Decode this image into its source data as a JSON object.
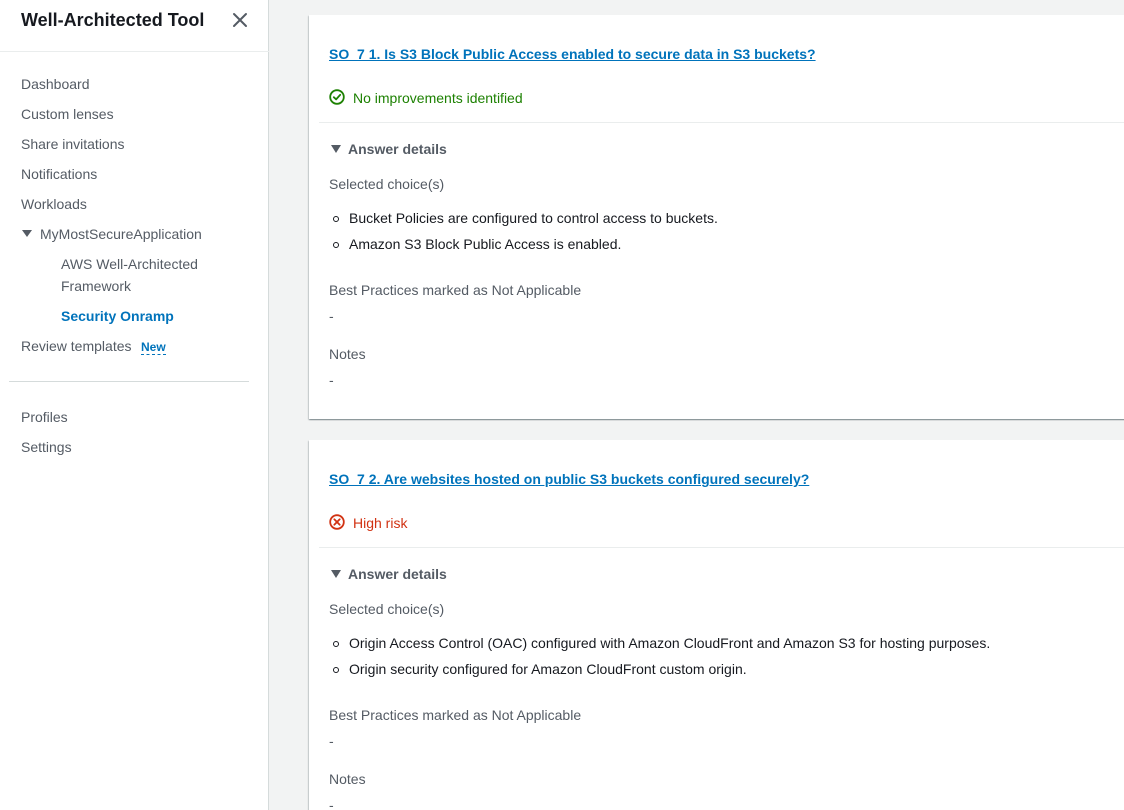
{
  "sidebar": {
    "title": "Well-Architected Tool",
    "nav": {
      "dashboard": "Dashboard",
      "custom_lenses": "Custom lenses",
      "share_invitations": "Share invitations",
      "notifications": "Notifications",
      "workloads": "Workloads",
      "workload_name": "MyMostSecureApplication",
      "lens_aws_line1": "AWS Well-Architected",
      "lens_aws_line2": "Framework",
      "lens_security": "Security Onramp",
      "review_templates": "Review templates",
      "new_badge": "New",
      "profiles": "Profiles",
      "settings": "Settings"
    }
  },
  "questions": [
    {
      "title": "SO_7 1. Is S3 Block Public Access enabled to secure data in S3 buckets?",
      "status": "No improvements identified",
      "status_type": "ok",
      "answer_details_label": "Answer details",
      "selected_label": "Selected choice(s)",
      "choices": [
        "Bucket Policies are configured to control access to buckets.",
        "Amazon S3 Block Public Access is enabled."
      ],
      "na_label": "Best Practices marked as Not Applicable",
      "na_value": "-",
      "notes_label": "Notes",
      "notes_value": "-"
    },
    {
      "title": "SO_7 2. Are websites hosted on public S3 buckets configured securely?",
      "status": "High risk",
      "status_type": "risk",
      "answer_details_label": "Answer details",
      "selected_label": "Selected choice(s)",
      "choices": [
        "Origin Access Control (OAC) configured with Amazon CloudFront and Amazon S3 for hosting purposes.",
        "Origin security configured for Amazon CloudFront custom origin."
      ],
      "na_label": "Best Practices marked as Not Applicable",
      "na_value": "-",
      "notes_label": "Notes",
      "notes_value": "-"
    }
  ],
  "colors": {
    "link": "#0073bb",
    "success": "#1d8102",
    "error": "#d13212",
    "text_secondary": "#545b64"
  }
}
